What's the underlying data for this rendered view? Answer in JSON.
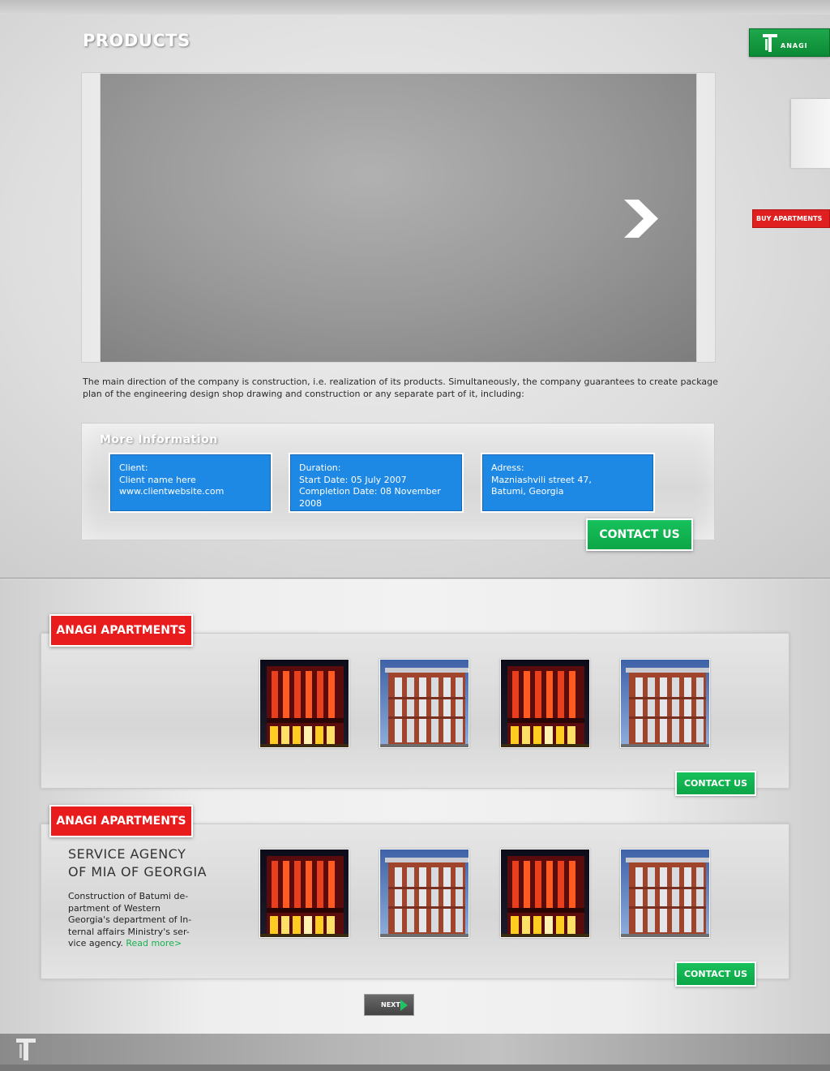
{
  "header": {
    "page_title": "PRODUCTS",
    "logo_text": "ANAGI",
    "side_button": "BUY APARTMENTS"
  },
  "intro": {
    "text": "The main direction of the company is construction, i.e. realization of its products. Simultaneously, the company guarantees to create package plan of the engineering design shop drawing and construction or any separate part of it, including:"
  },
  "info": {
    "title": "More Information",
    "client": {
      "lines": [
        "Client:",
        "Client name here",
        "www.clientwebsite.com"
      ]
    },
    "duration": {
      "lines": [
        "Duration:",
        "Start Date: 05 July 2007",
        "Completion Date: 08 November",
        "2008"
      ]
    },
    "address": {
      "lines": [
        "Adress:",
        "Mazniashvili street 47,",
        "Batumi, Georgia"
      ]
    },
    "contact_label": "CONTACT US"
  },
  "apartments": [
    {
      "tag": "ANAGI APARTMENTS",
      "contact_label": "CONTACT US",
      "thumbs": [
        "night-building",
        "day-building",
        "night-building",
        "day-building"
      ]
    },
    {
      "tag": "ANAGI APARTMENTS",
      "title_lines": [
        "SERVICE AGENCY",
        "OF MIA OF GEORGIA"
      ],
      "description": "Construction of Batumi de-partment of Western Georgia's department of In-ternal affairs Ministry's ser-vice agency.",
      "read_more": "Read more>",
      "contact_label": "CONTACT US",
      "thumbs": [
        "night-building",
        "day-building",
        "night-building",
        "day-building"
      ]
    }
  ],
  "pagination": {
    "next_label": "NEXT"
  },
  "colors": {
    "accent_green": "#0ca647",
    "accent_red": "#e81c1c",
    "info_blue": "#1e88e5"
  },
  "icons": {
    "logo": "anagi-logo-icon",
    "slider_next": "chevron-right-icon",
    "next_arrow": "play-arrow-icon"
  }
}
